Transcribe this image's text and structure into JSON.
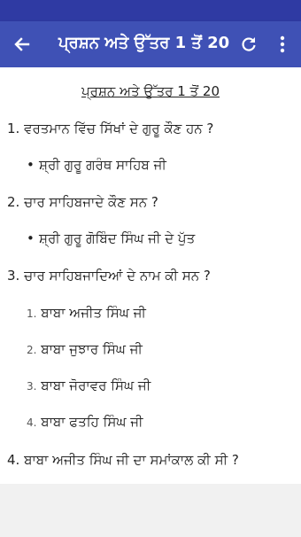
{
  "app_bar": {
    "title": "ਪ੍ਰਸ਼ਨ ਅਤੇ ਉੱਤਰ 1 ਤੋਂ 20",
    "back_icon": "back-arrow-icon",
    "refresh_icon": "refresh-icon",
    "more_icon": "more-vert-icon"
  },
  "content": {
    "heading": "ਪ੍ਰਸ਼ਨ ਅਤੇ ਉੱਤਰ 1 ਤੋਂ 20",
    "q1": "1. ਵਰਤਮਾਨ ਵਿੱਚ ਸਿੱਖਾਂ ਦੇ ਗੁਰੂ ਕੌਣ ਹਨ ?",
    "a1": "ਸ਼੍ਰੀ ਗੁਰੂ ਗਰੰਥ ਸਾਹਿਬ ਜੀ",
    "q2": "2. ਚਾਰ ਸਾਹਿਬਜਾਦੇ ਕੌਣ ਸਨ ?",
    "a2": "ਸ਼੍ਰੀ ਗੁਰੂ ਗੋਬਿੰਦ ਸਿੰਘ ਜੀ ਦੇ ਪੁੱਤ",
    "q3": "3. ਚਾਰ ਸਾਹਿਬਜਾਦਿਆਂ ਦੇ ਨਾਮ ਕੀ ਸਨ ?",
    "a3_items": [
      {
        "num": "1.",
        "text": "ਬਾਬਾ ਅਜੀਤ ਸਿੰਘ ਜੀ"
      },
      {
        "num": "2.",
        "text": "ਬਾਬਾ ਜੁਝਾਰ ਸਿੰਘ ਜੀ"
      },
      {
        "num": "3.",
        "text": "ਬਾਬਾ ਜੋਰਾਵਰ ਸਿੰਘ ਜੀ"
      },
      {
        "num": "4.",
        "text": "ਬਾਬਾ ਫਤਹਿ ਸਿੰਘ ਜੀ"
      }
    ],
    "q4": "4. ਬਾਬਾ ਅਜੀਤ ਸਿੰਘ ਜੀ ਦਾ ਸਮਾਂਕਾਲ ਕੀ ਸੀ ?"
  },
  "colors": {
    "app_bar": "#3f51b5",
    "status_bar": "#2f3aa3"
  }
}
